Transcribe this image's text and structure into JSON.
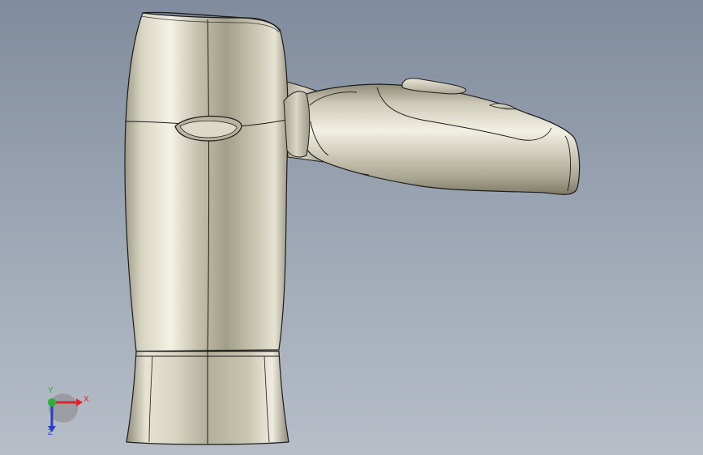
{
  "viewport": {
    "background_top": "#808b9d",
    "background_bottom": "#b7bec8"
  },
  "model": {
    "name_icon": "hair-dryer-3d-model",
    "body_color": "#c9c6b4",
    "edge_color": "#1c1c1c"
  },
  "triad": {
    "x_label": "X",
    "y_label": "Y",
    "z_label": "Z",
    "x_color": "#e0242a",
    "y_color": "#27b233",
    "z_color": "#2a3cc8"
  }
}
